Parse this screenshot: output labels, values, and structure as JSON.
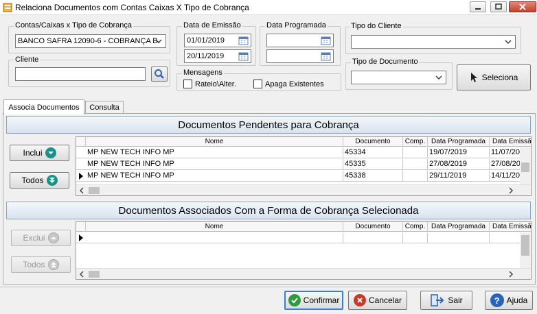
{
  "window": {
    "title": "Relaciona Documentos com Contas Caixas X Tipo de Cobrança"
  },
  "filters": {
    "contas_label": "Contas/Caixas x Tipo de Cobrança",
    "contas_value": "BANCO SAFRA 12090-6 - COBRANÇA B.",
    "cliente_label": "Cliente",
    "cliente_value": "",
    "emissao_label": "Data de Emissão",
    "emissao_from": "01/01/2019",
    "emissao_to": "20/11/2019",
    "programada_label": "Data Programada",
    "programada_from": "",
    "programada_to": "",
    "mensagens_label": "Mensagens",
    "rateio_label": "Rateio\\Alter.",
    "apaga_label": "Apaga Existentes",
    "tipo_cliente_label": "Tipo do Cliente",
    "tipo_cliente_value": "",
    "tipo_doc_label": "Tipo de Documento",
    "tipo_doc_value": "",
    "seleciona_label": "Seleciona"
  },
  "tabs": [
    {
      "label": "Associa Documentos",
      "active": true
    },
    {
      "label": "Consulta",
      "active": false
    }
  ],
  "pendentes": {
    "title": "Documentos Pendentes para Cobrança",
    "inclui_label": "Inclui",
    "todos_label": "Todos",
    "columns": [
      "Nome",
      "Documento",
      "Comp.",
      "Data Programada",
      "Data Emissão"
    ],
    "rows": [
      {
        "nome": "MP NEW TECH INFO MP",
        "documento": "45334",
        "comp": "",
        "programada": "19/07/2019",
        "emissao": "11/07/20"
      },
      {
        "nome": "MP NEW TECH INFO MP",
        "documento": "45335",
        "comp": "",
        "programada": "27/08/2019",
        "emissao": "27/08/20"
      },
      {
        "nome": "MP NEW TECH INFO MP",
        "documento": "45338",
        "comp": "",
        "programada": "29/11/2019",
        "emissao": "14/11/20"
      }
    ]
  },
  "associados": {
    "title": "Documentos Associados Com a Forma de Cobrança Selecionada",
    "exclui_label": "Exclui",
    "todos_label": "Todos",
    "columns": [
      "Nome",
      "Documento",
      "Comp.",
      "Data Programada",
      "Data Emissão"
    ]
  },
  "actions": {
    "confirmar": "Confirmar",
    "cancelar": "Cancelar",
    "sair": "Sair",
    "ajuda": "Ajuda"
  },
  "colors": {
    "accent": "#3a7fc9",
    "header_bg": "#d8e3ef",
    "confirm_green": "#2e9b3c",
    "cancel_red": "#c53a2d",
    "help_blue": "#2a64b8"
  }
}
